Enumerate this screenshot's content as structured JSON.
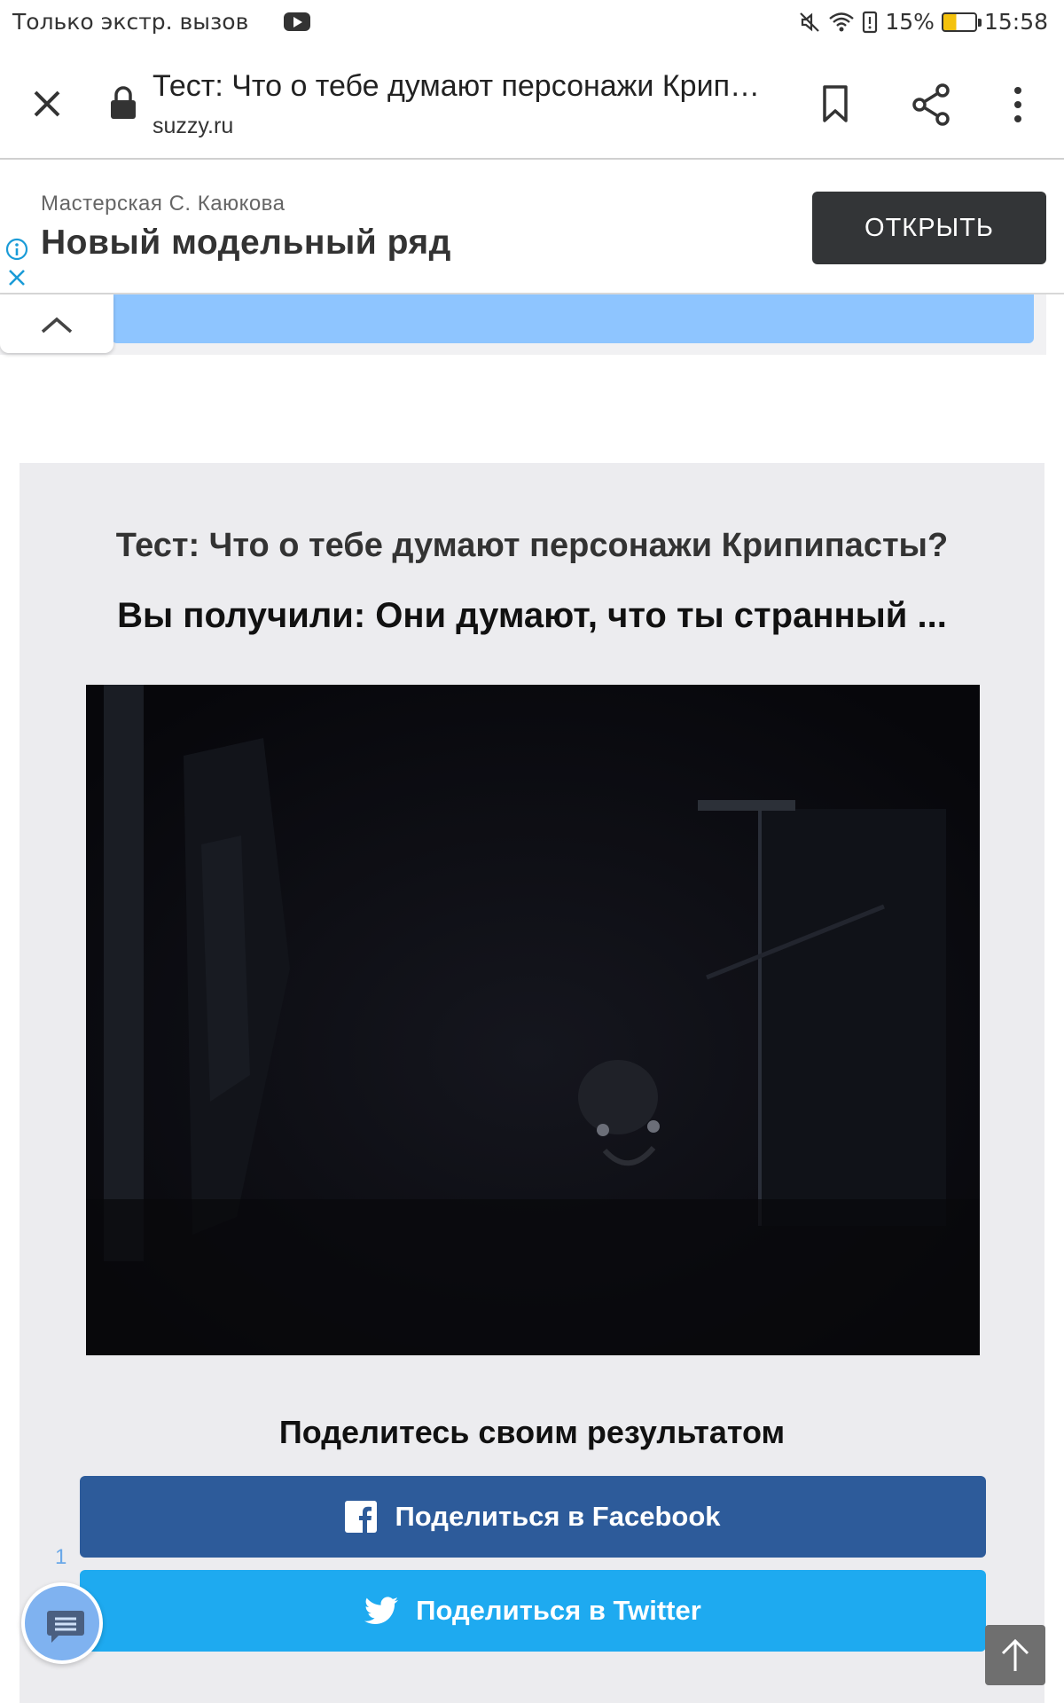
{
  "status_bar": {
    "carrier_text": "Только экстр. вызов",
    "battery_percent": "15%",
    "time": "15:58",
    "icons": [
      "youtube-icon",
      "mute-icon",
      "wifi-icon",
      "alarm-icon",
      "battery-icon"
    ]
  },
  "toolbar": {
    "page_title": "Тест: Что о тебе думают персонажи Крипипасты?",
    "url": "suzzy.ru",
    "icons": [
      "close-icon",
      "lock-icon",
      "bookmark-icon",
      "share-icon",
      "more-icon"
    ]
  },
  "ad": {
    "advertiser": "Мастерская С. Каюкова",
    "headline": "Новый модельный ряд",
    "cta_label": "ОТКРЫТЬ"
  },
  "result": {
    "title": "Тест: Что о тебе думают персонажи Крипипасты?",
    "result_text": "Вы получили: Они думают, что ты странный ...",
    "share_heading": "Поделитесь своим результатом",
    "facebook_label": "Поделиться в Facebook",
    "twitter_label": "Поделиться в Twitter"
  },
  "floating": {
    "badge_count": "1"
  },
  "colors": {
    "facebook": "#2d5b9a",
    "twitter": "#1eaaf0",
    "card_bg": "#ececef",
    "ad_button": "#333537"
  }
}
